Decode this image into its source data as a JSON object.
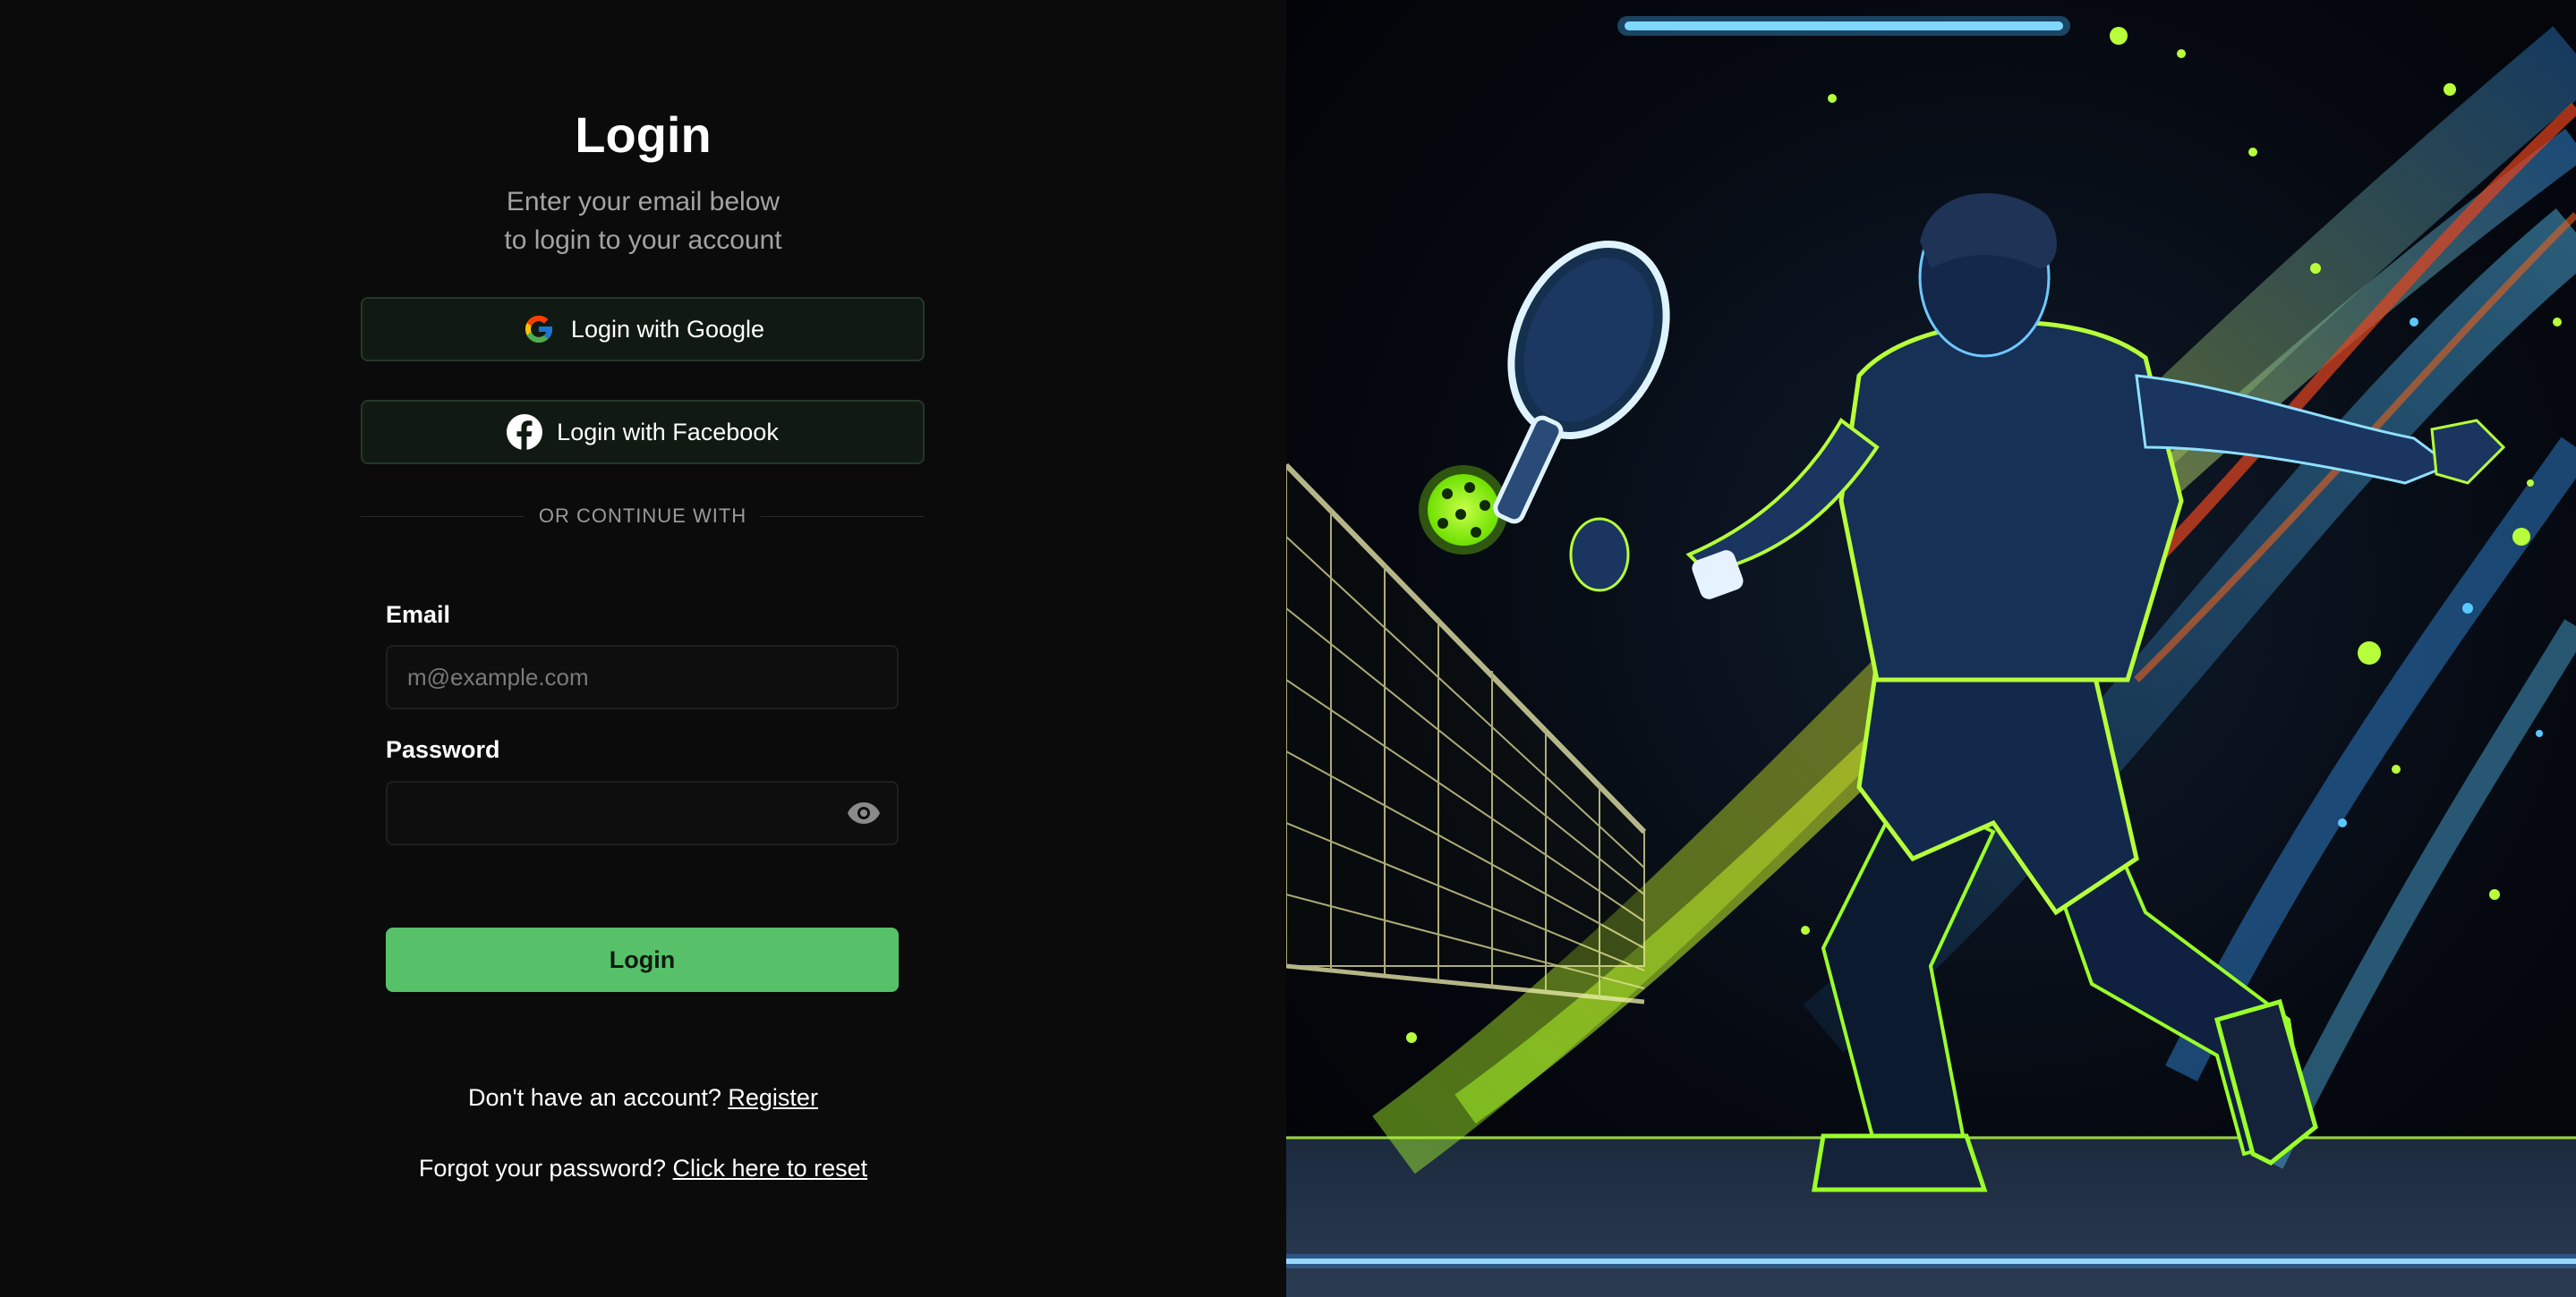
{
  "login": {
    "title": "Login",
    "subtitle_line1": "Enter your email below",
    "subtitle_line2": "to login to your account",
    "google_label": "Login with Google",
    "facebook_label": "Login with Facebook",
    "divider_text": "OR CONTINUE WITH",
    "email_label": "Email",
    "email_placeholder": "m@example.com",
    "email_value": "",
    "password_label": "Password",
    "password_value": "",
    "submit_label": "Login",
    "register_prompt": "Don't have an account?",
    "register_link": "Register",
    "reset_prompt": "Forgot your password?",
    "reset_link": "Click here to reset"
  },
  "icons": {
    "google": "google-logo-icon",
    "facebook": "facebook-logo-icon",
    "password_toggle": "eye-icon"
  },
  "colors": {
    "background": "#0b0b0b",
    "primary_button": "#57c169",
    "oauth_button_bg": "#111a12",
    "oauth_button_border": "#23382a",
    "muted_text": "#a3a3a3"
  },
  "hero": {
    "image_subject": "neon pickleball player illustration"
  }
}
